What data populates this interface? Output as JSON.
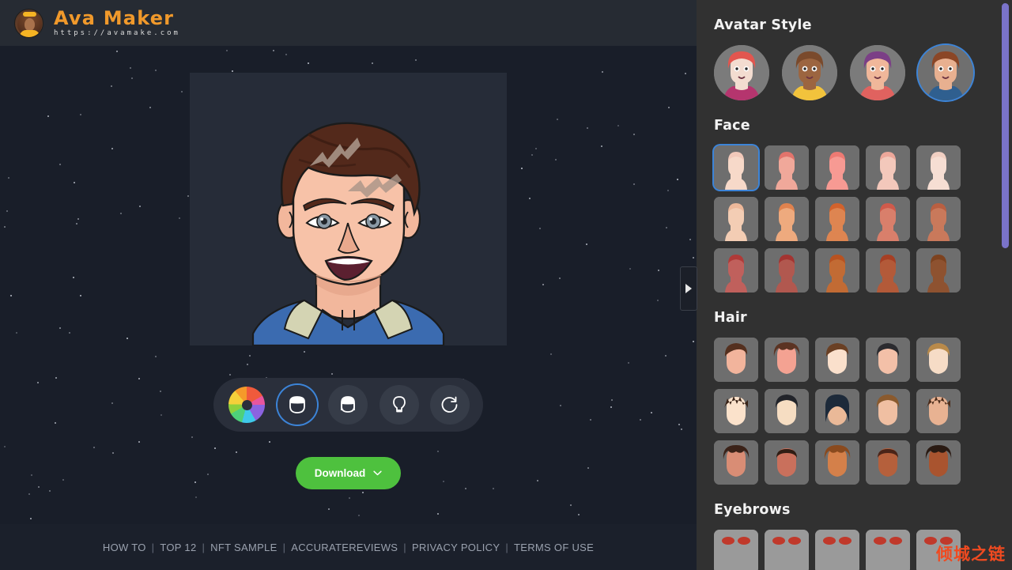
{
  "brand": {
    "title": "Ava Maker",
    "url": "https://avamake.com",
    "logo_icon": "woman-avatar-logo-icon"
  },
  "stage": {
    "preview_name": "avatar-preview-canvas",
    "background_color": "#191e29",
    "canvas_color": "#262c38"
  },
  "toolbar": {
    "items": [
      {
        "id": "color",
        "icon": "color-wheel-icon",
        "label": "Colors",
        "selected": false
      },
      {
        "id": "male",
        "icon": "male-face-icon",
        "label": "Male",
        "selected": true
      },
      {
        "id": "female",
        "icon": "female-face-icon",
        "label": "Female",
        "selected": false
      },
      {
        "id": "ideas",
        "icon": "lightbulb-icon",
        "label": "Ideas",
        "selected": false
      },
      {
        "id": "random",
        "icon": "refresh-icon",
        "label": "Randomize",
        "selected": false
      }
    ]
  },
  "download": {
    "label": "Download",
    "icon": "chevron-down-icon",
    "color": "#4ec13e"
  },
  "panel_toggle": {
    "icon": "triangle-right-icon",
    "label": "Collapse panel"
  },
  "footer": {
    "links": [
      "HOW TO",
      "TOP 12",
      "NFT SAMPLE",
      "ACCURATEREVIEWS",
      "PRIVACY POLICY",
      "TERMS OF USE"
    ],
    "separator": "|"
  },
  "panel": {
    "accent_color": "#3c84d8",
    "scrollbar_color": "#7a73c9",
    "sections": [
      {
        "id": "avatar-style",
        "title": "Avatar Style",
        "type": "circle-row",
        "selected_index": 3,
        "items": [
          {
            "id": "style-1",
            "name": "cartoon-boy-style",
            "hair": "#e2564f",
            "skin": "#f3dcd0",
            "shirt": "#b5356e",
            "bg": "#7b7b7b"
          },
          {
            "id": "style-2",
            "name": "illustrated-woman-style",
            "hair": "#7a4a2c",
            "skin": "#9c6540",
            "shirt": "#f2c33c",
            "bg": "#7b7b7b"
          },
          {
            "id": "style-3",
            "name": "flat-person-style",
            "hair": "#7b3f86",
            "skin": "#f0b79a",
            "shirt": "#e0625f",
            "bg": "#7b7b7b"
          },
          {
            "id": "style-4",
            "name": "realistic-woman-style",
            "hair": "#8b4626",
            "skin": "#e8b090",
            "shirt": "#2f5f8f",
            "bg": "#6f6f6f"
          }
        ]
      },
      {
        "id": "face",
        "title": "Face",
        "type": "tile-grid",
        "columns": 5,
        "selected_index": 0,
        "swatches": [
          "#f7d9c9",
          "#f0a89a",
          "#f79a93",
          "#f3c8bb",
          "#f6ded3",
          "#f3cdb4",
          "#eeaa7e",
          "#de8551",
          "#d97f6b",
          "#c9795b",
          "#c0605c",
          "#b1584f",
          "#c26b34",
          "#b35a39",
          "#8e5230"
        ],
        "hair_colors": [
          "#f2c9ba",
          "#e2746c",
          "#ee7a73",
          "#eda79a",
          "#f1cfc2",
          "#edb89a",
          "#e0824e",
          "#d2622c",
          "#cf5a4b",
          "#b95f41",
          "#b03a38",
          "#a33431",
          "#b85221",
          "#a63f24",
          "#7d421f"
        ]
      },
      {
        "id": "hair",
        "title": "Hair",
        "type": "tile-grid",
        "columns": 5,
        "selected_index": -1,
        "items": [
          {
            "id": "hair-1",
            "hair": "#54301f",
            "skin": "#f2b49c",
            "style": "swept"
          },
          {
            "id": "hair-2",
            "hair": "#5b3322",
            "skin": "#f4a292",
            "style": "curly"
          },
          {
            "id": "hair-3",
            "hair": "#6a4024",
            "skin": "#fae0cc",
            "style": "side-part"
          },
          {
            "id": "hair-4",
            "hair": "#2b2b2f",
            "skin": "#f3c0a8",
            "style": "short-dark"
          },
          {
            "id": "hair-5",
            "hair": "#b98a4a",
            "skin": "#f6dcc6",
            "style": "wavy-blond"
          },
          {
            "id": "hair-6",
            "hair": "#3a2418",
            "skin": "#fbe2cb",
            "style": "spiky"
          },
          {
            "id": "hair-7",
            "hair": "#22242a",
            "skin": "#f6ddc2",
            "style": "bowl"
          },
          {
            "id": "hair-8",
            "hair": "#1d2a3a",
            "skin": "#eab998",
            "style": "long-dark"
          },
          {
            "id": "hair-9",
            "hair": "#8a5a2e",
            "skin": "#f0bfa2",
            "style": "medium-brown"
          },
          {
            "id": "hair-10",
            "hair": "#4c2d1c",
            "skin": "#e8b292",
            "style": "tousled"
          },
          {
            "id": "hair-11",
            "hair": "#3b2218",
            "skin": "#d98d75",
            "style": "afro-small"
          },
          {
            "id": "hair-12",
            "hair": "#2f1d14",
            "skin": "#c9705c",
            "style": "flat-top"
          },
          {
            "id": "hair-13",
            "hair": "#8a4a1e",
            "skin": "#d4804a",
            "style": "curly-ginger"
          },
          {
            "id": "hair-14",
            "hair": "#4a2418",
            "skin": "#b5603c",
            "style": "buzz"
          },
          {
            "id": "hair-15",
            "hair": "#2a1a12",
            "skin": "#a9542f",
            "style": "coily"
          }
        ]
      },
      {
        "id": "eyebrows",
        "title": "Eyebrows",
        "type": "tile-grid",
        "columns": 5,
        "selected_index": -1,
        "items": [
          {
            "id": "brow-1",
            "color": "#c0392b"
          },
          {
            "id": "brow-2",
            "color": "#c0392b"
          },
          {
            "id": "brow-3",
            "color": "#c0392b"
          },
          {
            "id": "brow-4",
            "color": "#c0392b"
          },
          {
            "id": "brow-5",
            "color": "#c0392b"
          }
        ]
      }
    ]
  },
  "watermark": {
    "text": "倾城之链",
    "color": "#f04a20"
  }
}
